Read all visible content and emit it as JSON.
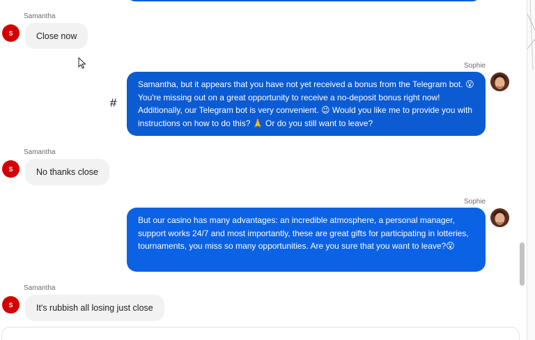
{
  "messages": [
    {
      "sender": "Samantha",
      "initial": "S",
      "text": "Close now"
    },
    {
      "sender": "Sophie",
      "text": "Samantha, but it appears that you have not yet received a bonus from the Telegram bot. 😮 You're missing out on a great opportunity to receive a no-deposit bonus right now! Additionally, our Telegram bot is very convenient. 😉 Would you like me to provide you with instructions on how to do this? 🙏 Or do you still want to leave?"
    },
    {
      "sender": "Samantha",
      "initial": "S",
      "text": "No thanks close"
    },
    {
      "sender": "Sophie",
      "text": "But our casino has many advantages: an incredible atmosphere, a personal manager, support works 24/7 and most importantly, these are great gifts for participating in lotteries, tournaments, you miss so many opportunities. Are you sure that you want to leave?😮"
    },
    {
      "sender": "Samantha",
      "initial": "S",
      "text": "It's rubbish all losing just close"
    }
  ],
  "hash_mark": "#",
  "colors": {
    "agent_bubble": "#0b5bd3",
    "user_bubble": "#f2f2f2",
    "avatar_red": "#d40000"
  }
}
